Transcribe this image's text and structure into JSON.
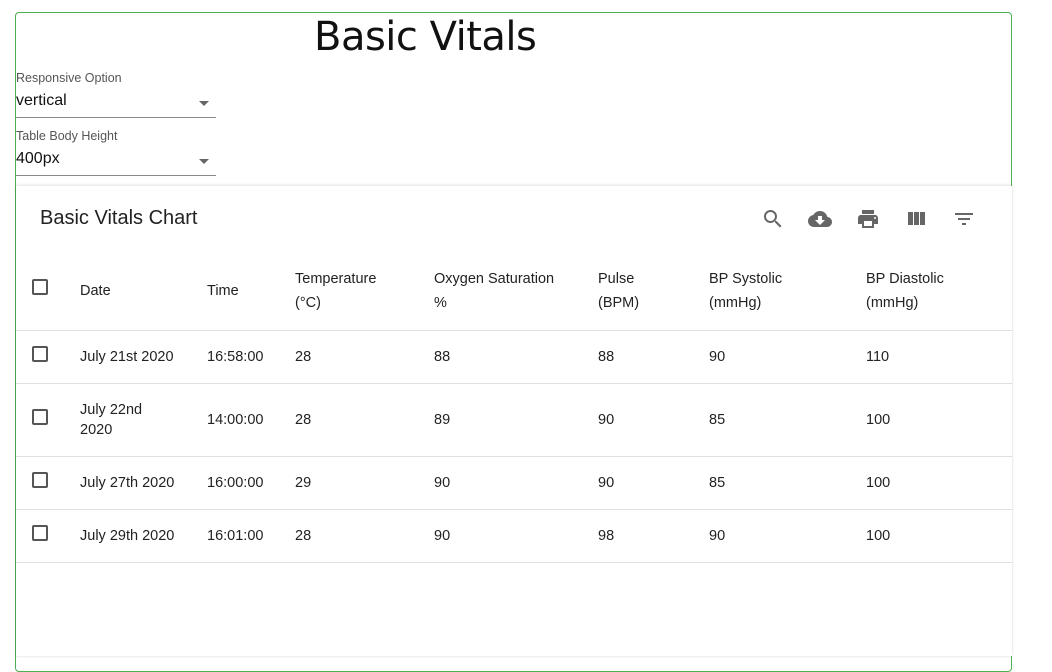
{
  "page": {
    "title": "Basic Vitals"
  },
  "controls": {
    "responsive": {
      "label": "Responsive Option",
      "value": "vertical"
    },
    "body_height": {
      "label": "Table Body Height",
      "value": "400px"
    }
  },
  "table": {
    "title": "Basic Vitals Chart",
    "toolbar_icons": [
      "search-icon",
      "download-icon",
      "print-icon",
      "view-columns-icon",
      "filter-icon"
    ],
    "columns": [
      {
        "line1": "Date",
        "line2": ""
      },
      {
        "line1": "Time",
        "line2": ""
      },
      {
        "line1": "Temperature",
        "line2": "(°C)"
      },
      {
        "line1": "Oxygen Saturation",
        "line2": "%"
      },
      {
        "line1": "Pulse",
        "line2": "(BPM)"
      },
      {
        "line1": "BP Systolic",
        "line2": "(mmHg)"
      },
      {
        "line1": "BP Diastolic",
        "line2": "(mmHg)"
      }
    ],
    "rows": [
      {
        "date": "July 21st 2020",
        "time": "16:58:00",
        "temp": "28",
        "oxygen": "88",
        "pulse": "88",
        "systolic": "90",
        "diastolic": "110"
      },
      {
        "date": "July 22nd 2020",
        "time": "14:00:00",
        "temp": "28",
        "oxygen": "89",
        "pulse": "90",
        "systolic": "85",
        "diastolic": "100"
      },
      {
        "date": "July 27th 2020",
        "time": "16:00:00",
        "temp": "29",
        "oxygen": "90",
        "pulse": "90",
        "systolic": "85",
        "diastolic": "100"
      },
      {
        "date": "July 29th 2020",
        "time": "16:01:00",
        "temp": "28",
        "oxygen": "90",
        "pulse": "98",
        "systolic": "90",
        "diastolic": "100"
      }
    ]
  }
}
